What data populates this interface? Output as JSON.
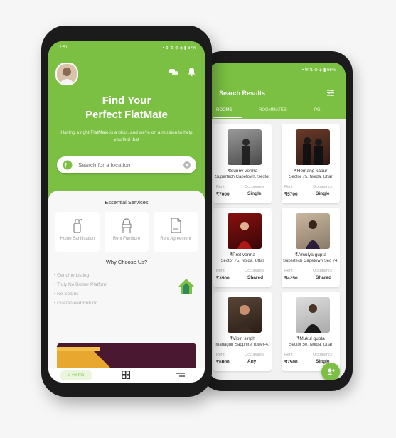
{
  "back": {
    "status_time": "",
    "status_icons": "• ✉ ⇅ ⊘ ◈ ▮ 66%",
    "title": "Search Results",
    "tabs": [
      "ROOMS",
      "ROOMMATES",
      "PG"
    ],
    "rent_label": "Rent",
    "occupancy_label": "Occupancy",
    "cards": [
      {
        "name": "₹Sunny verma",
        "address": "Supertech Capetown, Sector",
        "rent": "₹7000",
        "occupancy": "Single"
      },
      {
        "name": "₹Hemang kapur",
        "address": "Sector 75, Noida, Uttar",
        "rent": "₹5700",
        "occupancy": "Single"
      },
      {
        "name": "₹Pret verma",
        "address": "Sector 75, Noida, Uttar",
        "rent": "₹3500",
        "occupancy": "Shared"
      },
      {
        "name": "₹Amulya gupta",
        "address": "Supertech Capetown Sec 74,",
        "rent": "₹4250",
        "occupancy": "Shared"
      },
      {
        "name": "₹Vipin singh",
        "address": "Mahagun Sapphire Tower-4,",
        "rent": "₹6000",
        "occupancy": "Any"
      },
      {
        "name": "₹Mukul gupta",
        "address": "Sector 50, Noida, Uttar",
        "rent": "₹7500",
        "occupancy": "Single"
      }
    ]
  },
  "front": {
    "status_time": "12:51",
    "status_icons": "• ⊕ ⇅ ⊘ ◈ ▮ 67%",
    "hero_title_1": "Find Your",
    "hero_title_2": "Perfect FlatMate",
    "hero_sub": "Having a right FlatMate is a bliss, and we're on a mission to help you find that",
    "search_placeholder": "Search for a location",
    "services_title": "Essential Services",
    "services": [
      "Home Sanitisation",
      "Rent Furniture",
      "Rent Agreement"
    ],
    "why_title": "Why Choose Us?",
    "reasons": [
      "Genuine Listing",
      "Truly No Broker Platform",
      "No Spams",
      "Guaranteed Refund"
    ],
    "nav_home": "Home"
  },
  "colors": {
    "brand": "#7bc043",
    "dark": "#1b1b1b"
  }
}
